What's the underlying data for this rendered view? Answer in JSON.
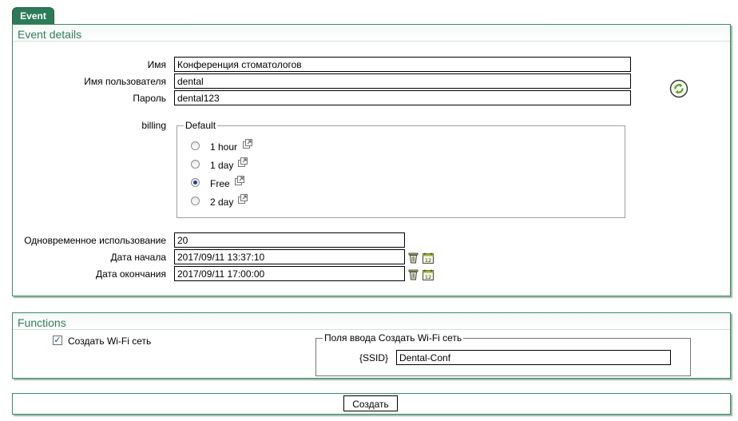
{
  "tab": {
    "label": "Event"
  },
  "event_details": {
    "title": "Event details",
    "fields": {
      "name": {
        "label": "Имя",
        "value": "Конференция стоматологов"
      },
      "username": {
        "label": "Имя пользователя",
        "value": "dental"
      },
      "password": {
        "label": "Пароль",
        "value": "dental123"
      }
    },
    "billing": {
      "label": "billing",
      "group_legend": "Default",
      "options": [
        {
          "label": "1 hour",
          "selected": false
        },
        {
          "label": "1 day",
          "selected": false
        },
        {
          "label": "Free",
          "selected": true
        },
        {
          "label": "2 day",
          "selected": false
        }
      ]
    },
    "concurrent_use": {
      "label": "Одновременное использование",
      "value": "20"
    },
    "start_date": {
      "label": "Дата начала",
      "value": "2017/09/11 13:37:10"
    },
    "end_date": {
      "label": "Дата окончания",
      "value": "2017/09/11 17:00:00"
    },
    "refresh_icon": "refresh-icon",
    "colors": {
      "accent": "#2d7a59",
      "panel_border": "#3f8a67",
      "title": "#2f7d5b"
    }
  },
  "functions": {
    "title": "Functions",
    "create_wifi": {
      "label": "Создать Wi-Fi сеть",
      "checked": true
    },
    "wifi_fields": {
      "legend": "Поля ввода Создать Wi-Fi сеть",
      "ssid_label": "{SSID}",
      "ssid_value": "Dental-Conf"
    }
  },
  "footer": {
    "create_button": "Создать"
  }
}
